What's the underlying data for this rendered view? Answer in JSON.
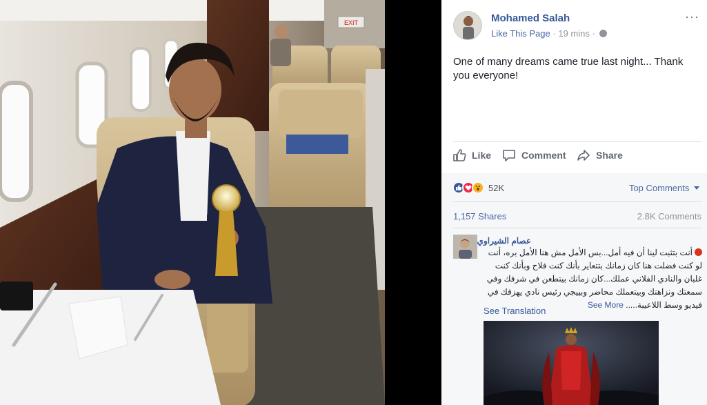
{
  "post": {
    "author": "Mohamed Salah",
    "like_page": "Like This Page",
    "separator": "·",
    "time": "19 mins",
    "more": "···",
    "text": "One of many dreams came true last night... Thank you everyone!"
  },
  "actions": {
    "like": "Like",
    "comment": "Comment",
    "share": "Share"
  },
  "stats": {
    "reactions_count": "52K",
    "top_comments": "Top Comments",
    "shares": "1,157 Shares",
    "comments": "2.8K Comments"
  },
  "photo": {
    "exit_sign": "EXIT"
  },
  "comment": {
    "author": "عصام الشيراوي",
    "text": "أنت بتثبت لينا أن فيه أمل...بس الأمل مش هنا الأمل بره، أنت لو كنت فضلت هنا كان زمانك بتتعاير بأنك كنت فلاح وبأنك كنت غلبان والنادي الفلاني عملك...كان زمانك بيتطعن في شرفك وفي سمعتك ونزاهتك وبيتعملك محاضر وبييجي رئيس نادي يهزقك في فيديو وسط اللاعيبة.....",
    "see_more": "See More",
    "see_translation": "See Translation"
  },
  "colors": {
    "link": "#365899",
    "like_blue": "#3b5998",
    "love_red": "#f0284a",
    "wow_yellow": "#f7b125"
  }
}
